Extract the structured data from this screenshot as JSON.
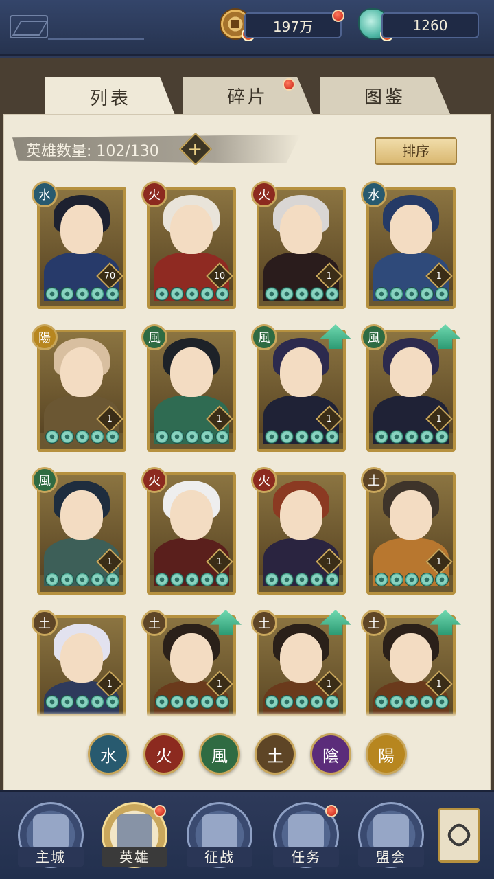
{
  "currency": {
    "coins": "197万",
    "gems": "1260"
  },
  "tabs": [
    {
      "label": "列表",
      "active": true
    },
    {
      "label": "碎片",
      "active": false
    },
    {
      "label": "图鉴",
      "active": false
    }
  ],
  "hero_count": {
    "label": "英雄数量: 102/130",
    "plus": "+"
  },
  "sort_button": "排序",
  "element_glyphs": {
    "water": "水",
    "fire": "火",
    "wind": "風",
    "earth": "土",
    "yin": "陰",
    "yang": "陽"
  },
  "heroes": [
    {
      "element": "水",
      "level": "70",
      "upgrade": false,
      "hair": "#1d2130",
      "robe": "#273a6a"
    },
    {
      "element": "火",
      "level": "10",
      "upgrade": false,
      "hair": "#e9e4da",
      "robe": "#8f2a22"
    },
    {
      "element": "火",
      "level": "1",
      "upgrade": false,
      "hair": "#d9d6d4",
      "robe": "#2a1c1c"
    },
    {
      "element": "水",
      "level": "1",
      "upgrade": false,
      "hair": "#253a66",
      "robe": "#2f4a7a"
    },
    {
      "element": "陽",
      "level": "1",
      "upgrade": false,
      "hair": "#d8bfa0",
      "robe": "#6b5733"
    },
    {
      "element": "風",
      "level": "1",
      "upgrade": false,
      "hair": "#1d2228",
      "robe": "#2f6b52"
    },
    {
      "element": "風",
      "level": "1",
      "upgrade": true,
      "hair": "#2c2a4e",
      "robe": "#1f2236"
    },
    {
      "element": "風",
      "level": "1",
      "upgrade": true,
      "hair": "#2c2a4e",
      "robe": "#1f2236"
    },
    {
      "element": "風",
      "level": "1",
      "upgrade": false,
      "hair": "#1e2d3e",
      "robe": "#3d5f58"
    },
    {
      "element": "火",
      "level": "1",
      "upgrade": false,
      "hair": "#eeeeee",
      "robe": "#5a1f1c"
    },
    {
      "element": "火",
      "level": "1",
      "upgrade": false,
      "hair": "#8b3a22",
      "robe": "#2a2440"
    },
    {
      "element": "土",
      "level": "1",
      "upgrade": false,
      "hair": "#3e342a",
      "robe": "#b8772f"
    },
    {
      "element": "土",
      "level": "1",
      "upgrade": false,
      "hair": "#e2e2ef",
      "robe": "#2e3a5c"
    },
    {
      "element": "土",
      "level": "1",
      "upgrade": true,
      "hair": "#2a2019",
      "robe": "#6a3a1c"
    },
    {
      "element": "土",
      "level": "1",
      "upgrade": true,
      "hair": "#2a2019",
      "robe": "#6a3a1c"
    },
    {
      "element": "土",
      "level": "1",
      "upgrade": true,
      "hair": "#2a2019",
      "robe": "#6a3a1c"
    }
  ],
  "filters": [
    {
      "glyph": "水",
      "class": "el-water"
    },
    {
      "glyph": "火",
      "class": "el-fire"
    },
    {
      "glyph": "風",
      "class": "el-wind"
    },
    {
      "glyph": "土",
      "class": "el-earth"
    },
    {
      "glyph": "陰",
      "class": "el-yin"
    },
    {
      "glyph": "陽",
      "class": "el-yang"
    }
  ],
  "nav": [
    {
      "label": "主城",
      "active": false,
      "dot": false
    },
    {
      "label": "英雄",
      "active": true,
      "dot": true
    },
    {
      "label": "征战",
      "active": false,
      "dot": false
    },
    {
      "label": "任务",
      "active": false,
      "dot": true
    },
    {
      "label": "盟会",
      "active": false,
      "dot": false
    }
  ]
}
